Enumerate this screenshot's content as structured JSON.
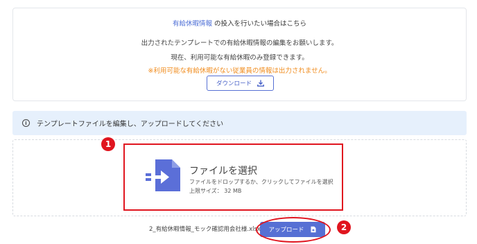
{
  "top_card": {
    "link_text": "有給休暇情報",
    "link_suffix": "の投入を行いたい場合はこちら",
    "line2": "出力されたテンプレートでの有給休暇情報の編集をお願いします。",
    "line3": "現在、利用可能な有給休暇のみ登録できます。",
    "line4": "※利用可能な有給休暇がない従業員の情報は出力されません。",
    "download_label": "ダウンロード"
  },
  "info_bar": {
    "icon_glyph": "i",
    "text": "テンプレートファイルを編集し、アップロードしてください"
  },
  "file_select": {
    "title": "ファイルを選択",
    "subtitle": "ファイルをドロップするか、クリックしてファイルを選択",
    "size_limit": "上限サイズ： 32 MB"
  },
  "upload": {
    "filename": "2_有給休暇情報_モック確認用会社様.xlsx",
    "button_label": "アップロード"
  },
  "annotations": {
    "badge1": "1",
    "badge2": "2"
  },
  "colors": {
    "accent": "#5670d4",
    "warning": "#f08c1e",
    "annotation_red": "#e0151f",
    "info_bg": "#e6f0fc"
  },
  "icons": [
    "download-icon",
    "info-icon",
    "file-import-icon",
    "upload-icon"
  ]
}
